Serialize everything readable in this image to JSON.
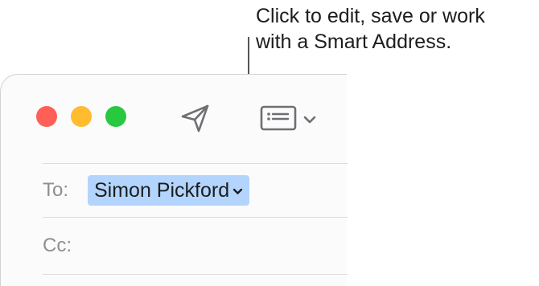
{
  "callout": {
    "text": "Click to edit, save or work\nwith a Smart Address."
  },
  "window": {
    "traffic_lights": [
      "#fe5f57",
      "#febc2e",
      "#28c840"
    ],
    "toolbar": {
      "send_icon": "paper-plane-icon",
      "header_icon": "header-fields-icon",
      "header_menu_icon": "chevron-down-icon"
    },
    "fields": {
      "to_label": "To:",
      "to_recipient": "Simon Pickford",
      "cc_label": "Cc:"
    }
  }
}
